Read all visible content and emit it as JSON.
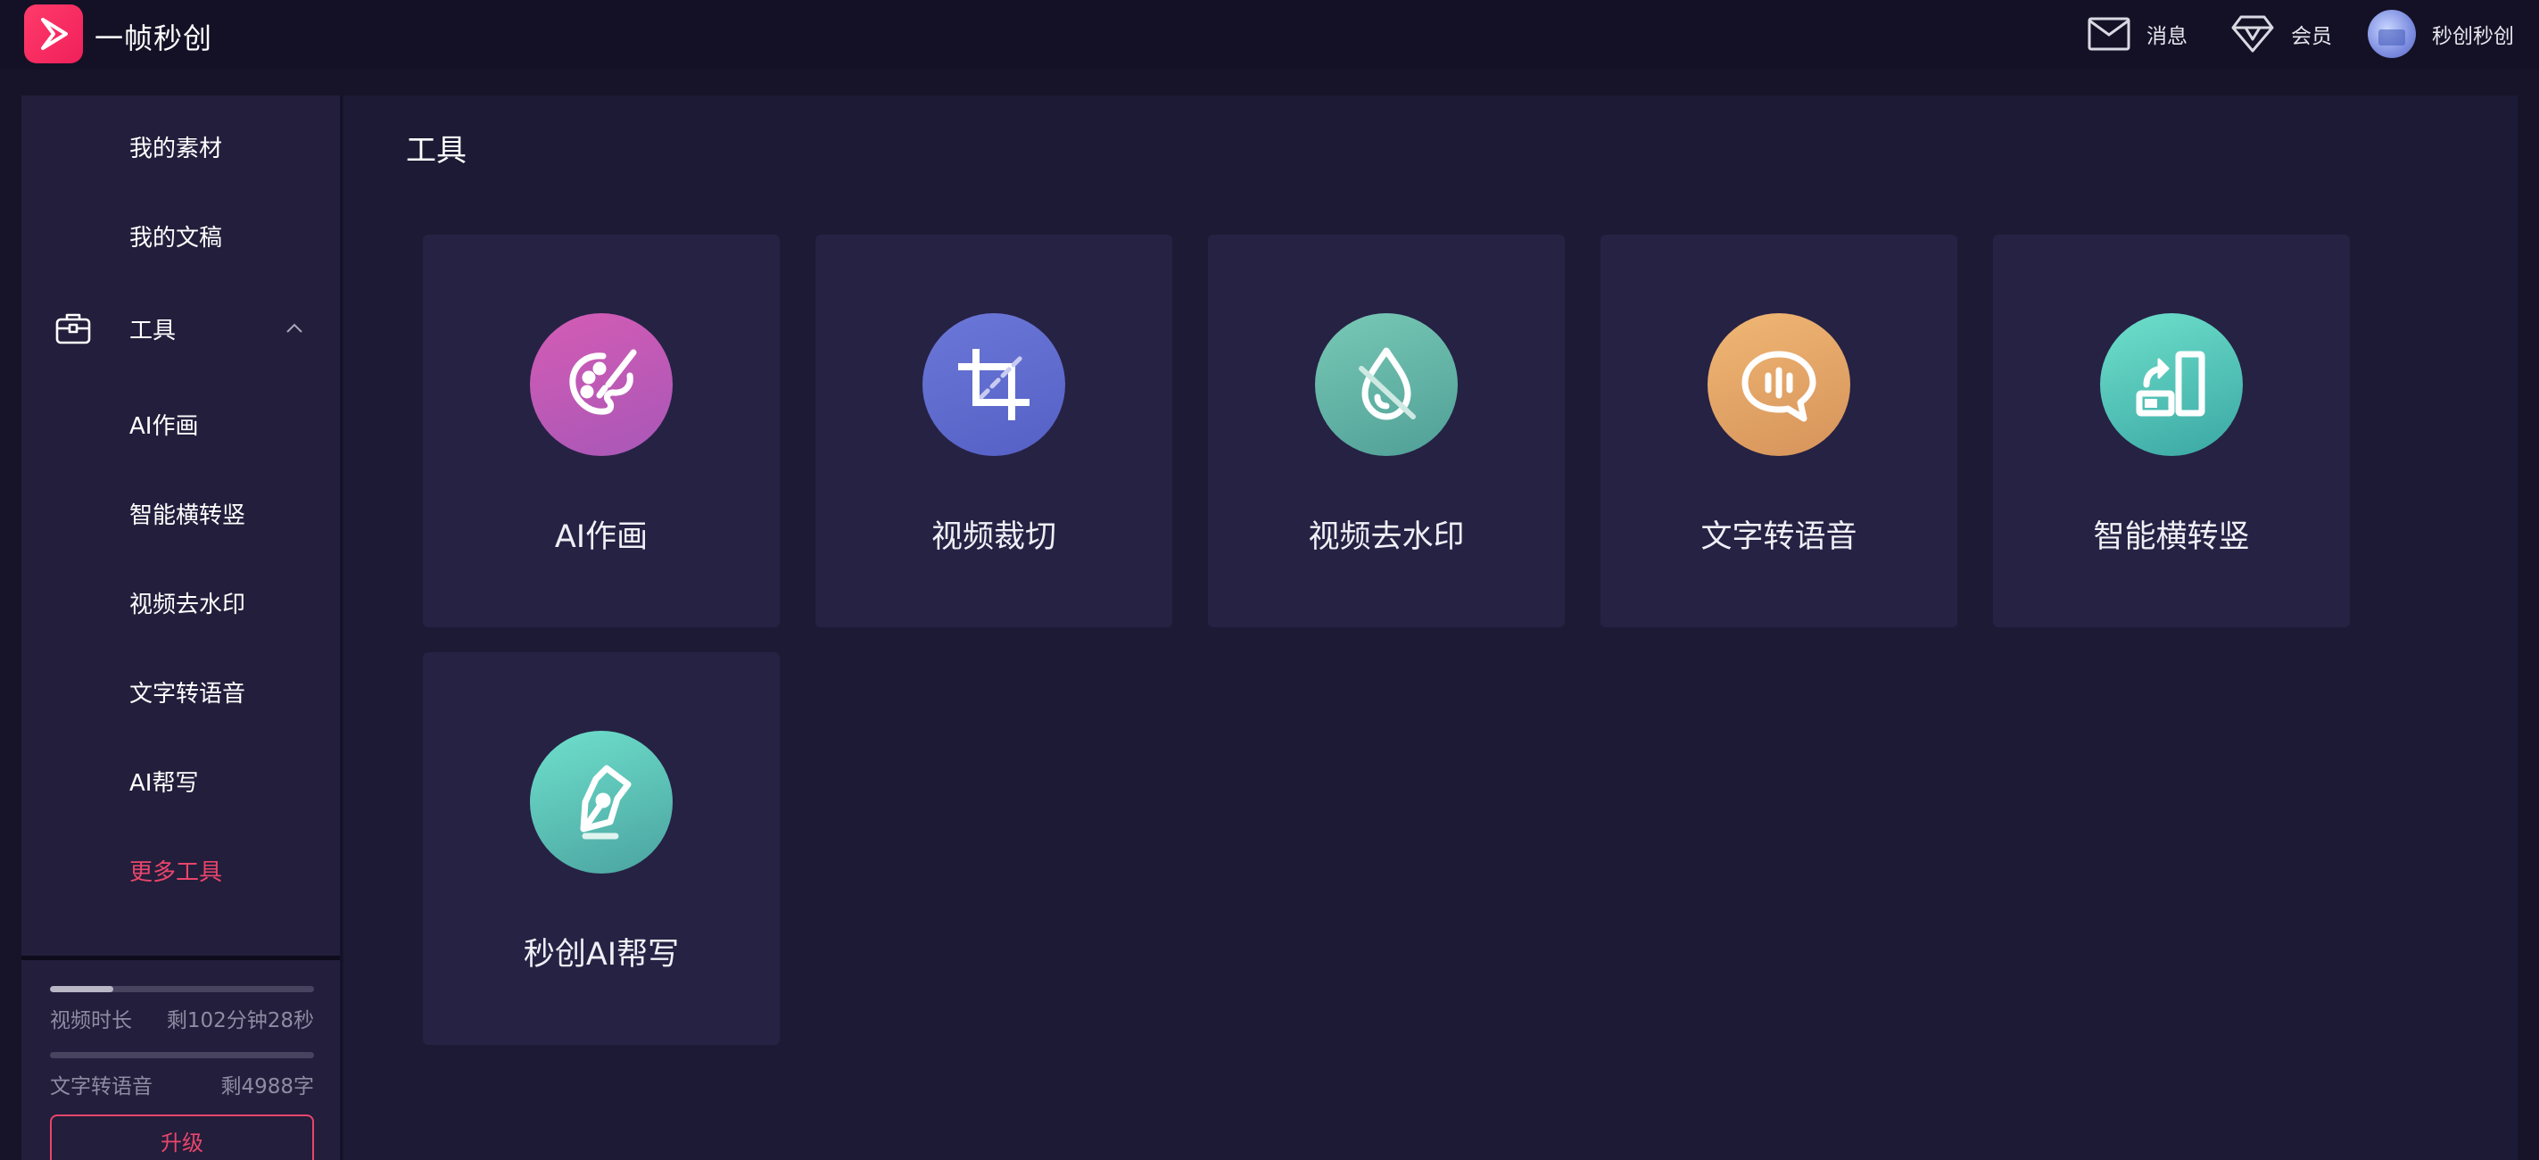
{
  "header": {
    "app_title": "一帧秒创",
    "messages_label": "消息",
    "vip_label": "会员",
    "user_name": "秒创秒创"
  },
  "sidebar": {
    "items": [
      {
        "label": "我的素材"
      },
      {
        "label": "我的文稿"
      },
      {
        "label": "工具",
        "icon": "briefcase-icon",
        "expanded": true
      },
      {
        "label": "AI作画"
      },
      {
        "label": "智能横转竖"
      },
      {
        "label": "视频去水印"
      },
      {
        "label": "文字转语音"
      },
      {
        "label": "AI帮写"
      },
      {
        "label": "更多工具",
        "highlight_color": "#e9456b"
      }
    ],
    "quota": [
      {
        "label": "视频时长",
        "value": "剩102分钟28秒",
        "used_fraction": 0.24
      },
      {
        "label": "文字转语音",
        "value": "剩4988字",
        "used_fraction": 0.0
      }
    ],
    "upgrade_label": "升级"
  },
  "main": {
    "title": "工具",
    "tools": [
      {
        "name": "AI作画",
        "icon": "palette-icon",
        "color": "#c25ab6"
      },
      {
        "name": "视频裁切",
        "icon": "crop-icon",
        "color": "#5f6bd0"
      },
      {
        "name": "视频去水印",
        "icon": "no-watermark-icon",
        "color": "#5fb3a6"
      },
      {
        "name": "文字转语音",
        "icon": "speech-bubble-icon",
        "color": "#e3a466"
      },
      {
        "name": "智能横转竖",
        "icon": "rotate-screen-icon",
        "color": "#4cc0b4"
      },
      {
        "name": "秒创AI帮写",
        "icon": "pen-nib-icon",
        "color": "#5cc4b4"
      }
    ]
  },
  "colors": {
    "accent": "#e9456b",
    "background": "#171429",
    "card": "#262244"
  }
}
